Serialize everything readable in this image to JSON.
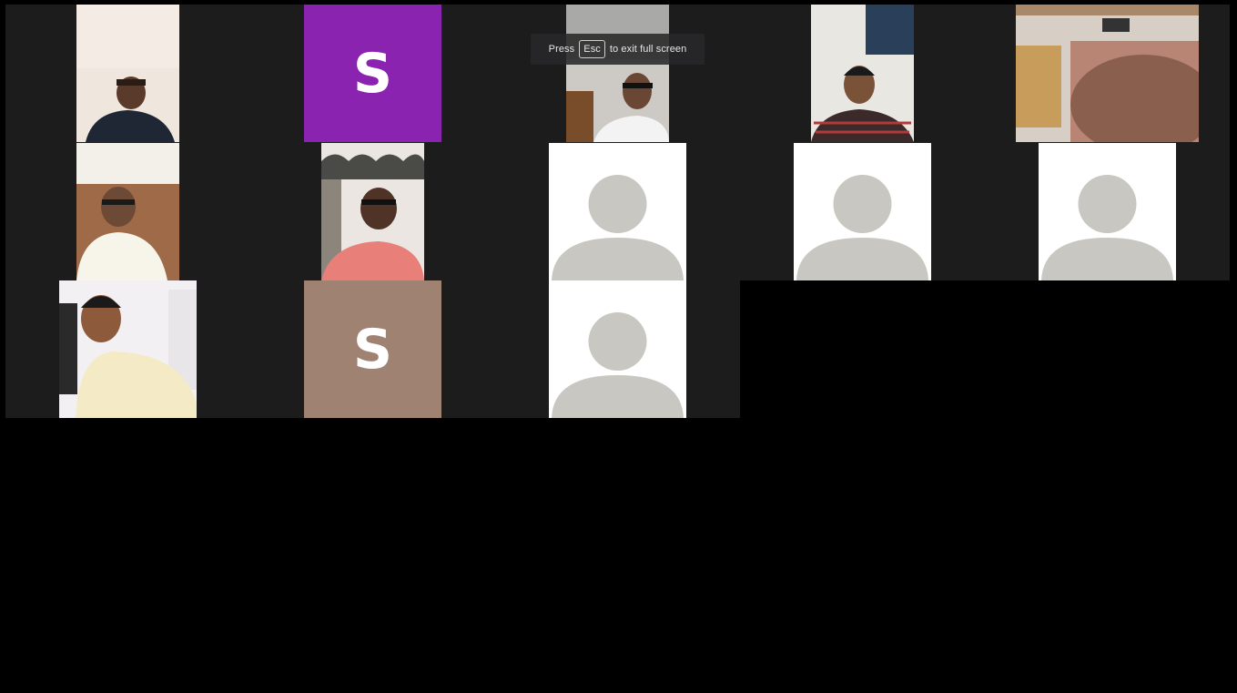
{
  "fullscreen_hint": {
    "prefix": "Press",
    "key": "Esc",
    "suffix": "to exit full screen"
  },
  "participants": [
    {
      "type": "video",
      "row": 1,
      "col": 1
    },
    {
      "type": "initial",
      "initial": "S",
      "color": "#8a23b0",
      "row": 1,
      "col": 2
    },
    {
      "type": "video",
      "row": 1,
      "col": 3
    },
    {
      "type": "video",
      "row": 1,
      "col": 4
    },
    {
      "type": "video",
      "row": 1,
      "col": 5
    },
    {
      "type": "video",
      "row": 2,
      "col": 1
    },
    {
      "type": "video",
      "row": 2,
      "col": 2
    },
    {
      "type": "placeholder",
      "row": 2,
      "col": 3
    },
    {
      "type": "placeholder",
      "row": 2,
      "col": 4
    },
    {
      "type": "placeholder",
      "row": 2,
      "col": 5
    },
    {
      "type": "video",
      "row": 3,
      "col": 1
    },
    {
      "type": "initial",
      "initial": "S",
      "color": "#a08273",
      "row": 3,
      "col": 2
    },
    {
      "type": "placeholder",
      "row": 3,
      "col": 3
    }
  ]
}
